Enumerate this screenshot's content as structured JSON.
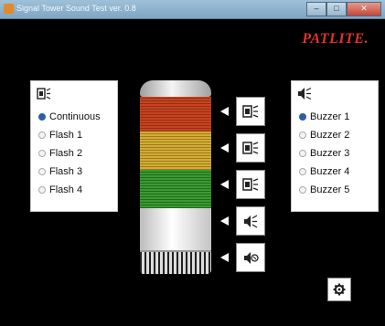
{
  "window": {
    "title": "Signal Tower Sound Test ver. 0.8",
    "controls": [
      "minimize-icon",
      "maximize-icon",
      "close-icon"
    ]
  },
  "logo": "PATLITE.",
  "light_panel": {
    "icon": "light-mode-icon",
    "options": [
      {
        "label": "Continuous",
        "selected": true
      },
      {
        "label": "Flash 1",
        "selected": false
      },
      {
        "label": "Flash 2",
        "selected": false
      },
      {
        "label": "Flash 3",
        "selected": false
      },
      {
        "label": "Flash 4",
        "selected": false
      }
    ]
  },
  "buzzer_panel": {
    "icon": "speaker-icon",
    "options": [
      {
        "label": "Buzzer 1",
        "selected": true
      },
      {
        "label": "Buzzer 2",
        "selected": false
      },
      {
        "label": "Buzzer 3",
        "selected": false
      },
      {
        "label": "Buzzer 4",
        "selected": false
      },
      {
        "label": "Buzzer 5",
        "selected": false
      }
    ]
  },
  "tower": {
    "segments": [
      {
        "name": "red",
        "color": "#c4451f"
      },
      {
        "name": "amber",
        "color": "#d2ad36"
      },
      {
        "name": "green",
        "color": "#3c9a31"
      },
      {
        "name": "white",
        "color": "#ffffff"
      }
    ]
  },
  "unit_buttons": [
    "light-red-icon",
    "light-amber-icon",
    "light-green-icon",
    "speaker-icon",
    "buzzer-icon"
  ],
  "settings_icon": "gear-icon",
  "colors": {
    "accent": "#2b5ea8",
    "logo": "#e0332a",
    "background": "#000000"
  }
}
